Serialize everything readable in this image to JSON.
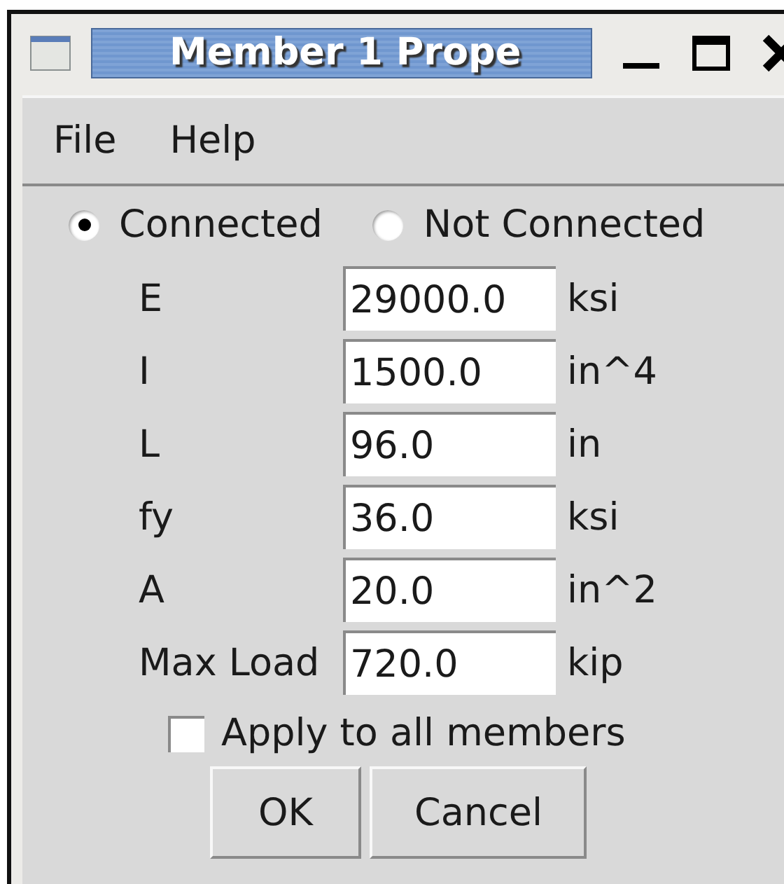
{
  "window": {
    "title": "Member 1 Prope"
  },
  "menu": [
    "File",
    "Help"
  ],
  "connection": [
    {
      "label": "Connected",
      "selected": true
    },
    {
      "label": "Not Connected",
      "selected": false
    }
  ],
  "properties": [
    {
      "label": "E",
      "value": "29000.0",
      "unit": "ksi"
    },
    {
      "label": "I",
      "value": "1500.0",
      "unit": "in^4"
    },
    {
      "label": "L",
      "value": "96.0",
      "unit": "in"
    },
    {
      "label": "fy",
      "value": "36.0",
      "unit": "ksi"
    },
    {
      "label": "A",
      "value": "20.0",
      "unit": "in^2"
    },
    {
      "label": "Max Load",
      "value": "720.0",
      "unit": "kip"
    }
  ],
  "apply_all": {
    "label": "Apply to all members",
    "checked": false
  },
  "buttons": [
    "OK",
    "Cancel"
  ]
}
